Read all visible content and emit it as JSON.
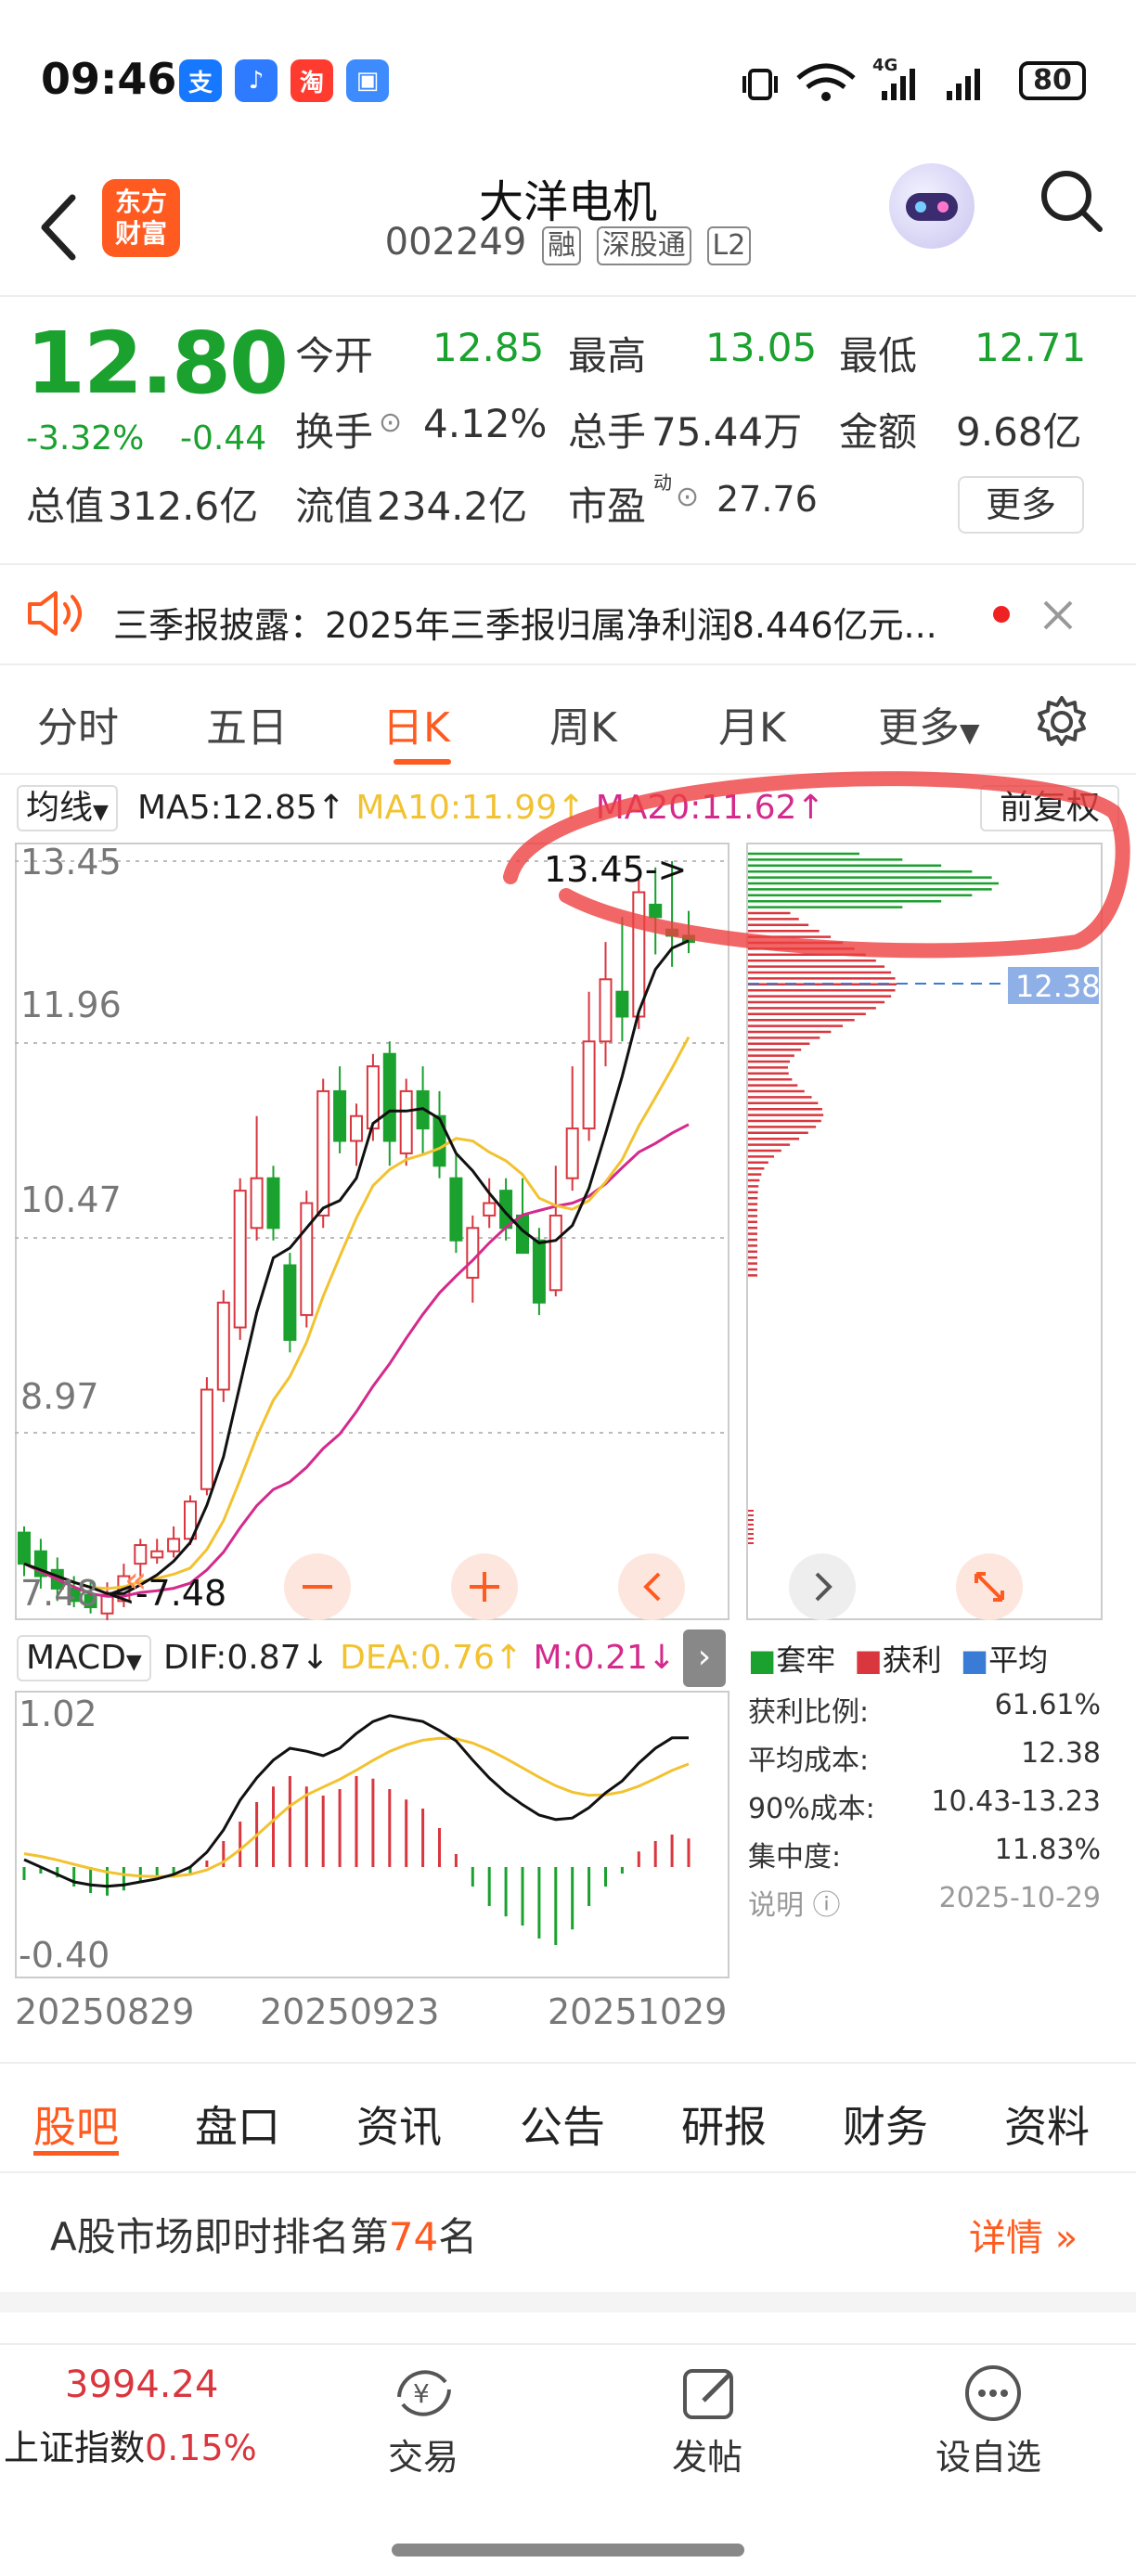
{
  "status_bar": {
    "time": "09:46",
    "battery": "80",
    "net": "4G",
    "app_icons": [
      "支",
      "♪",
      "淘",
      "▣"
    ]
  },
  "header": {
    "logo_text": "东方\n财富",
    "name": "大洋电机",
    "code": "002249",
    "tags": [
      "融",
      "深股通",
      "L2"
    ]
  },
  "quote": {
    "price": "12.80",
    "change_pct": "-3.32%",
    "change": "-0.44",
    "open_label": "今开",
    "open": "12.85",
    "high_label": "最高",
    "high": "13.05",
    "low_label": "最低",
    "low": "12.71",
    "turnover_label": "换手",
    "turnover": "4.12%",
    "volume_label": "总手",
    "volume": "75.44万",
    "amount_label": "金额",
    "amount": "9.68亿",
    "mcap_label": "总值",
    "mcap": "312.6亿",
    "float_label": "流值",
    "float": "234.2亿",
    "pe_label": "市盈",
    "pe_sup": "动",
    "pe": "27.76",
    "more": "更多"
  },
  "notice": {
    "text": "三季报披露：2025年三季报归属净利润8.446亿元..."
  },
  "tabs": [
    "分时",
    "五日",
    "日K",
    "周K",
    "月K",
    "更多"
  ],
  "active_tab": "日K",
  "ma_legend": {
    "selector": "均线",
    "ma5": "MA5:12.85",
    "ma10": "MA10:11.99",
    "ma20": "MA20:11.62",
    "adj": "前复权"
  },
  "kline": {
    "y_labels": [
      "13.45",
      "11.96",
      "10.47",
      "8.97",
      "7.48"
    ],
    "max_marker": "13.45->",
    "min_marker": "<-7.48",
    "avg_price_label": "12.38"
  },
  "chips_legend": {
    "trapped": "套牢",
    "profit": "获利",
    "avg": "平均"
  },
  "chip_stats": [
    {
      "label": "获利比例:",
      "value": "61.61%"
    },
    {
      "label": "平均成本:",
      "value": "12.38"
    },
    {
      "label": "90%成本:",
      "value": "10.43-13.23"
    },
    {
      "label": "集中度:",
      "value": "11.83%"
    },
    {
      "label": "说明",
      "value": "2025-10-29"
    }
  ],
  "macd": {
    "selector": "MACD",
    "dif": "DIF:0.87",
    "dea": "DEA:0.76",
    "m": "M:0.21",
    "y_top": "1.02",
    "y_bottom": "-0.40"
  },
  "dates": [
    "20250829",
    "20250923",
    "20251029"
  ],
  "sub_nav": [
    "股吧",
    "盘口",
    "资讯",
    "公告",
    "研报",
    "财务",
    "资料"
  ],
  "active_sub_nav": "股吧",
  "rank": {
    "prefix": "A股市场即时排名第",
    "num": "74",
    "suffix": "名",
    "detail": "详情"
  },
  "bottom_bar": {
    "index_value": "3994.24",
    "index_name": "上证指数",
    "index_change": "0.15%",
    "items": [
      "交易",
      "发帖",
      "设自选"
    ]
  },
  "colors": {
    "accent": "#ff5a1f",
    "up": "#d9363e",
    "down": "#1aa12e",
    "ma10": "#f2c230",
    "ma20": "#d42a8c",
    "avg": "#3a7bd5"
  }
}
